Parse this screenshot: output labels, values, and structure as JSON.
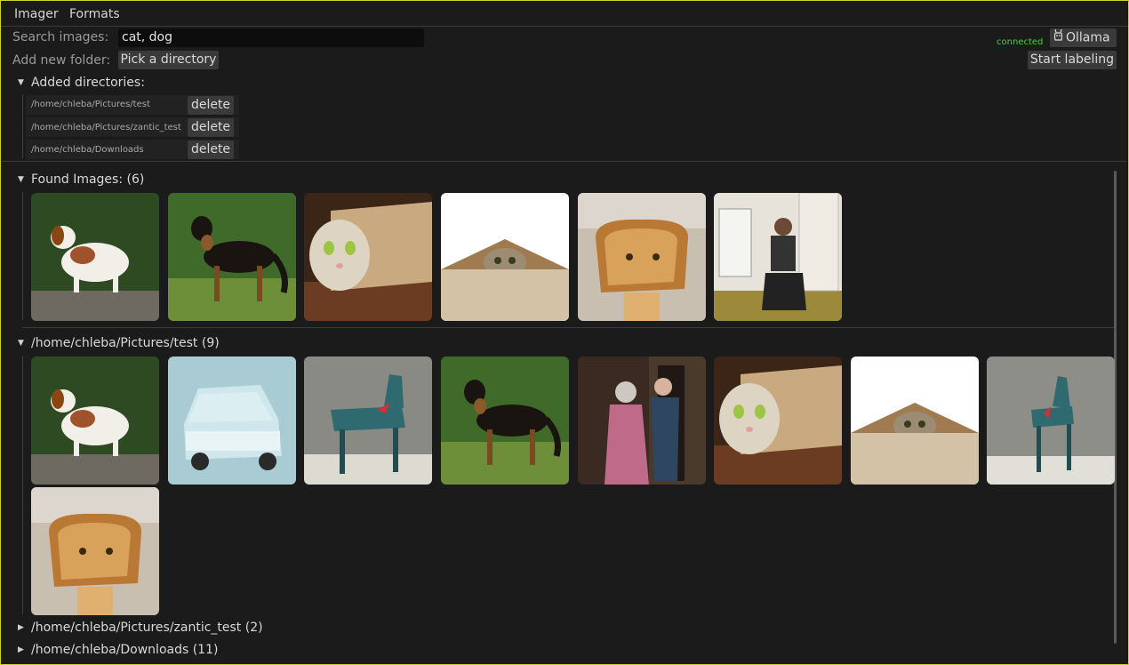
{
  "menu": {
    "imager": "Imager",
    "formats": "Formats"
  },
  "search": {
    "label": "Search images:",
    "value": "cat, dog"
  },
  "folder": {
    "label": "Add new folder:",
    "button": "Pick a directory"
  },
  "status": {
    "connected": "connected",
    "ollama": "Ollama",
    "start_labeling": "Start labeling"
  },
  "directories": {
    "title": "Added directories:",
    "items": [
      {
        "path": "/home/chleba/Pictures/test",
        "delete": "delete"
      },
      {
        "path": "/home/chleba/Pictures/zantic_test",
        "delete": "delete"
      },
      {
        "path": "/home/chleba/Downloads",
        "delete": "delete"
      }
    ]
  },
  "found": {
    "title": "Found Images: (6)",
    "thumbs": [
      "dog-brittany",
      "dog-shepherd",
      "cat-paper-roll",
      "cat-peeking-box",
      "cat-bread-face",
      "person-kitchen"
    ]
  },
  "groups": [
    {
      "title": "/home/chleba/Pictures/test (9)",
      "expanded": true,
      "thumbs": [
        "dog-brittany",
        "car-blue",
        "wooden-horse",
        "dog-shepherd",
        "people-doorway",
        "cat-paper-roll",
        "cat-peeking-box",
        "wooden-horse-2",
        "cat-bread-face"
      ]
    },
    {
      "title": "/home/chleba/Pictures/zantic_test (2)",
      "expanded": false
    },
    {
      "title": "/home/chleba/Downloads (11)",
      "expanded": false
    }
  ],
  "icons": {
    "expanded": "triangle-down-icon",
    "collapsed": "triangle-right-icon",
    "ollama": "llama-icon"
  }
}
